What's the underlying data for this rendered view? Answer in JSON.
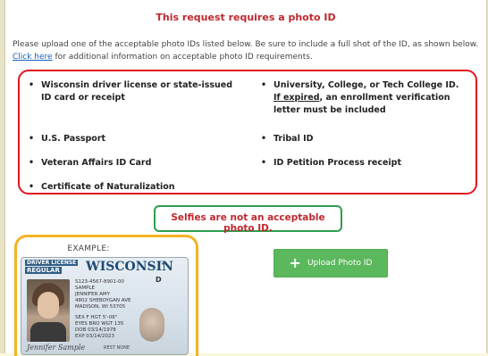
{
  "title": "This request requires a photo ID",
  "intro": {
    "text_before": "Please upload one of the acceptable photo IDs listed below. Be sure to include a full shot of the ID, as shown below.",
    "link": "Click here",
    "text_after": "for additional information on acceptable photo ID requirements."
  },
  "ids": {
    "left": [
      "Wisconsin driver license or state-issued ID card or receipt",
      "U.S. Passport",
      "Veteran Affairs ID Card",
      "Certificate of Naturalization"
    ],
    "right": {
      "college": {
        "line": "University, College, or Tech College ID.",
        "expired_prefix": "If expired",
        "expired_rest": ", an enrollment verification letter must be included"
      },
      "tribal": "Tribal ID",
      "petition": "ID Petition Process receipt"
    }
  },
  "selfie_warning": "Selfies are not an acceptable photo ID.",
  "example": {
    "label": "EXAMPLE:",
    "card": {
      "type_line1": "DRIVER LICENSE",
      "type_line2": "REGULAR",
      "state": "WISCONSIN",
      "class": "D",
      "details": [
        "S123-4567-8901-00",
        "SAMPLE",
        "JENNIFER AMY",
        "",
        "4802 SHEBOYGAN AVE",
        "MADISON, WI 53705"
      ],
      "details2": [
        "SEX F   HGT 5'-06\"",
        "EYES BRO   WGT 135",
        "DOB 03/14/1978",
        "EXP 03/14/2023",
        "REST NONE"
      ],
      "signature": "Jennifer Sample"
    }
  },
  "upload_button": "Upload Photo ID",
  "colors": {
    "title_red": "#c0272d",
    "box_red": "#e0151c",
    "box_green": "#2e9e4e",
    "box_yellow": "#f4b323",
    "button_green": "#5cb85c"
  }
}
